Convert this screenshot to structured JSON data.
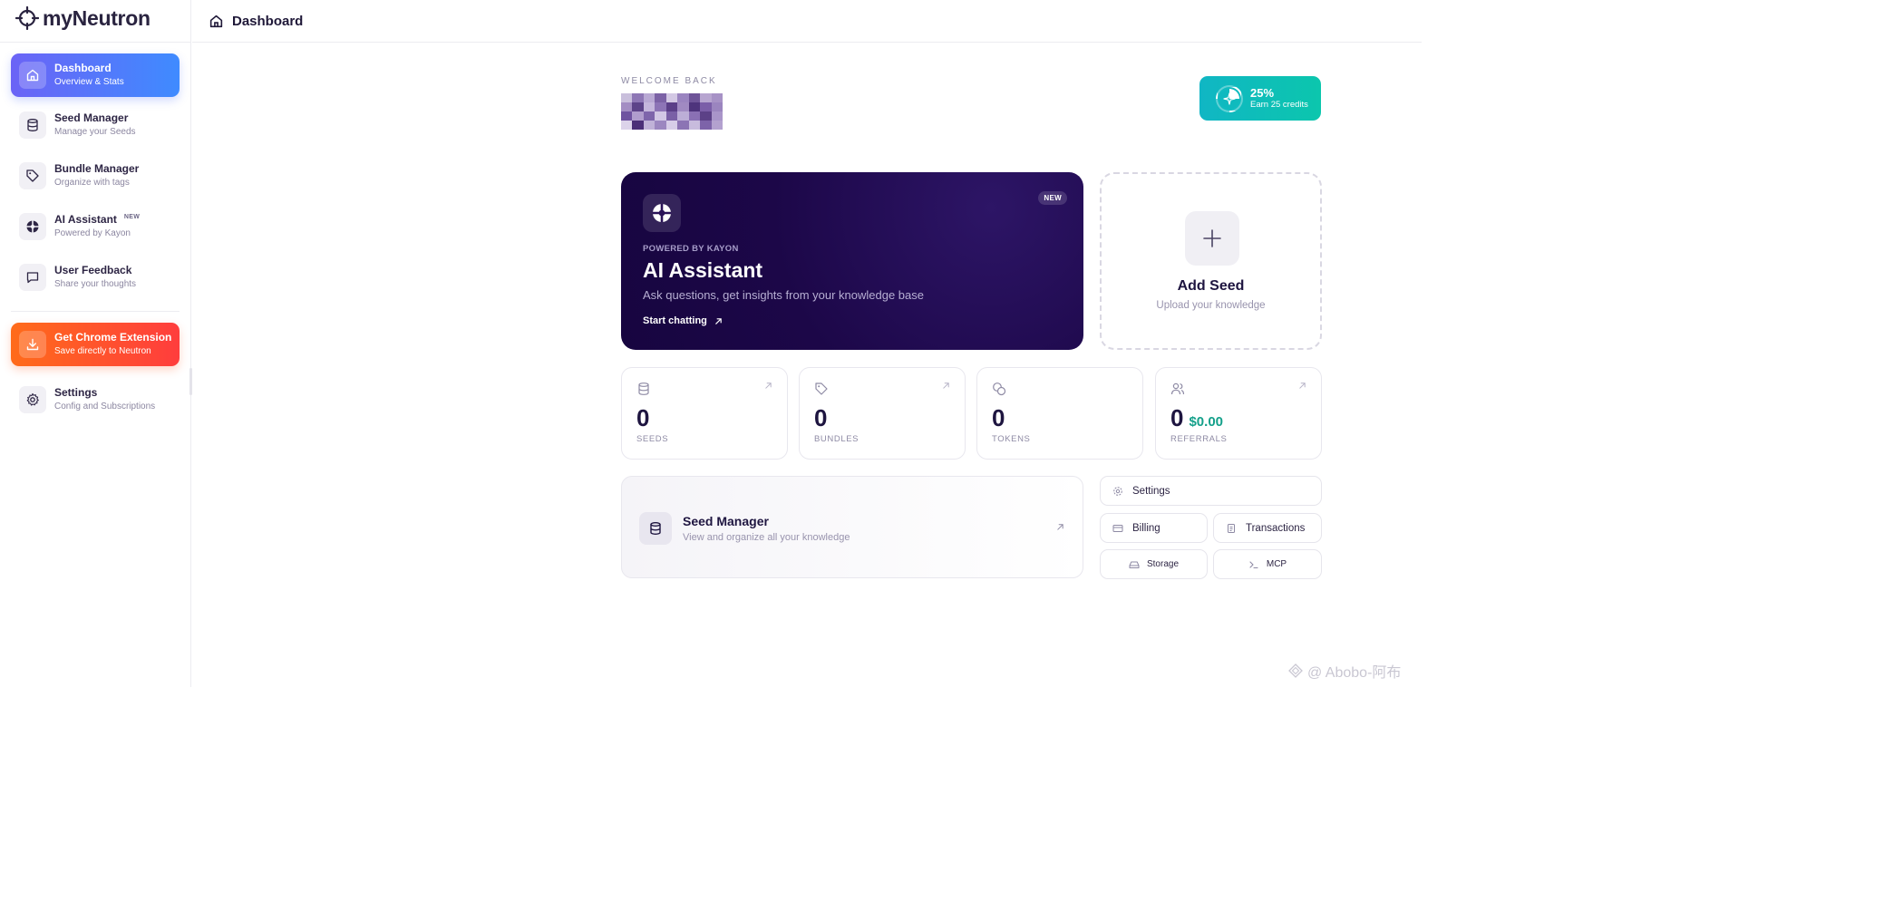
{
  "app": {
    "name": "myNeutron"
  },
  "colors": {
    "accent": "#4f74fb",
    "orange": "#ff5a2a",
    "teal": "#10b9b8",
    "dark_purple": "#1c0748",
    "money_green": "#14a08a"
  },
  "sidebar": {
    "items": [
      {
        "label": "Dashboard",
        "sub": "Overview & Stats",
        "icon": "home-icon",
        "active": true
      },
      {
        "label": "Seed Manager",
        "sub": "Manage your Seeds",
        "icon": "database-icon"
      },
      {
        "label": "Bundle Manager",
        "sub": "Organize with tags",
        "icon": "tag-icon"
      },
      {
        "label": "AI Assistant",
        "sub": "Powered by Kayon",
        "badge": "NEW",
        "icon": "kayon-icon"
      },
      {
        "label": "User Feedback",
        "sub": "Share your thoughts",
        "icon": "message-icon"
      }
    ],
    "extension": {
      "label": "Get Chrome Extension",
      "sub": "Save directly to Neutron",
      "icon": "download-icon"
    },
    "settings": {
      "label": "Settings",
      "sub": "Config and Subscriptions",
      "icon": "gear-icon"
    }
  },
  "header": {
    "title": "Dashboard",
    "icon": "home-icon"
  },
  "welcome": {
    "label": "WELCOME BACK"
  },
  "credits": {
    "percent": "25%",
    "sub": "Earn 25 credits",
    "progress": 0.25
  },
  "ai_card": {
    "badge": "NEW",
    "kicker": "POWERED BY KAYON",
    "title": "AI Assistant",
    "description": "Ask questions, get insights from your knowledge base",
    "cta": "Start chatting"
  },
  "add_seed": {
    "title": "Add Seed",
    "sub": "Upload your knowledge"
  },
  "stats": [
    {
      "value": "0",
      "label": "SEEDS",
      "icon": "database-icon"
    },
    {
      "value": "0",
      "label": "BUNDLES",
      "icon": "tag-icon"
    },
    {
      "value": "0",
      "label": "TOKENS",
      "icon": "coins-icon"
    },
    {
      "value": "0",
      "money": "$0.00",
      "label": "REFERRALS",
      "icon": "users-icon"
    }
  ],
  "seed_manager_card": {
    "title": "Seed Manager",
    "sub": "View and organize all your knowledge"
  },
  "quick_links": {
    "settings": "Settings",
    "billing": "Billing",
    "transactions": "Transactions",
    "storage": "Storage",
    "mcp": "MCP"
  },
  "watermark": {
    "text": "@ Abobo-阿布"
  }
}
